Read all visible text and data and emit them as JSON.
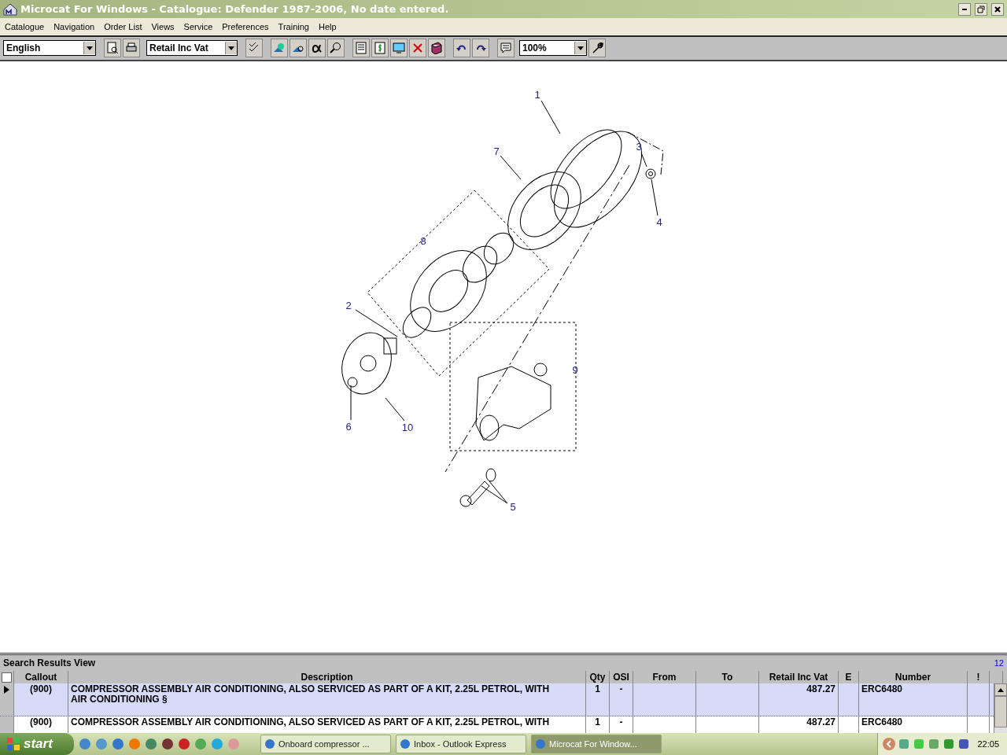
{
  "window": {
    "title": "Microcat For Windows - Catalogue: Defender 1987-2006, No date entered."
  },
  "menu": [
    "Catalogue",
    "Navigation",
    "Order List",
    "Views",
    "Service",
    "Preferences",
    "Training",
    "Help"
  ],
  "toolbar": {
    "language": "English",
    "price_type": "Retail Inc Vat",
    "zoom": "100%"
  },
  "diagram": {
    "callouts": [
      {
        "label": "1"
      },
      {
        "label": "7"
      },
      {
        "label": "3"
      },
      {
        "label": "4"
      },
      {
        "label": "8"
      },
      {
        "label": "2"
      },
      {
        "label": "9"
      },
      {
        "label": "6"
      },
      {
        "label": "10"
      },
      {
        "label": "5"
      }
    ]
  },
  "results": {
    "title": "Search Results View",
    "count": "12",
    "select_all_checked": false,
    "columns": [
      "Callout",
      "Description",
      "Qty",
      "OSI",
      "From",
      "To",
      "Retail Inc Vat",
      "E",
      "Number",
      "!"
    ],
    "rows": [
      {
        "selected": true,
        "cells": [
          "(900)",
          "COMPRESSOR ASSEMBLY AIR CONDITIONING, ALSO SERVICED AS PART OF A KIT, 2.25L PETROL, WITH AIR CONDITIONING §",
          "1",
          "-",
          "",
          "",
          "487.27",
          "",
          "ERC6480",
          ""
        ]
      },
      {
        "selected": false,
        "cells": [
          "(900)",
          "COMPRESSOR ASSEMBLY AIR CONDITIONING, ALSO SERVICED AS PART OF A KIT, 2.25L PETROL, WITH",
          "1",
          "-",
          "",
          "",
          "487.27",
          "",
          "ERC6480",
          ""
        ]
      }
    ]
  },
  "taskbar": {
    "start": "start",
    "tasks": [
      {
        "label": "Onboard compressor ...",
        "selected": false
      },
      {
        "label": "Inbox - Outlook Express",
        "selected": false
      },
      {
        "label": "Microcat For Window...",
        "selected": true
      }
    ],
    "clock": "22:05"
  }
}
